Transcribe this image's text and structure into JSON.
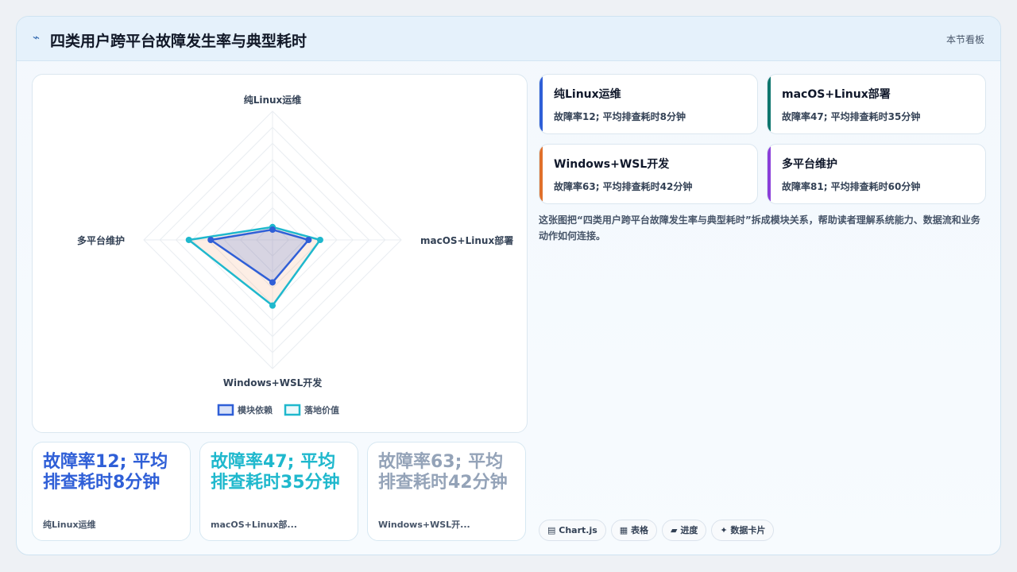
{
  "header": {
    "icon": "chart-line-icon",
    "title": "四类用户跨平台故障发生率与典型耗时",
    "right_label": "本节看板"
  },
  "chart_data": {
    "type": "radar",
    "axes": [
      "纯Linux运维",
      "macOS+Linux部署",
      "Windows+WSL开发",
      "多平台维护"
    ],
    "rlim": [
      0,
      100
    ],
    "grid": true,
    "legend_position": "bottom",
    "series": [
      {
        "name": "模块依赖",
        "values": [
          8,
          28,
          33,
          48
        ],
        "color": "#2f5fd7"
      },
      {
        "name": "落地价值",
        "values": [
          10,
          37,
          51,
          65
        ],
        "color": "#1fb8cd"
      }
    ]
  },
  "stat_cards": [
    {
      "value": "故障率12; 平均排查耗时8分钟",
      "label": "纯Linux运维",
      "color": "#2f5fd7"
    },
    {
      "value": "故障率47; 平均排查耗时35分钟",
      "label": "macOS+Linux部...",
      "color": "#1fb8cd"
    },
    {
      "value": "故障率63; 平均排查耗时42分钟",
      "label": "Windows+WSL开...",
      "color": "#94a3b8"
    }
  ],
  "info_cards": [
    {
      "title": "纯Linux运维",
      "desc": "故障率12; 平均排查耗时8分钟",
      "accent": "#2f5fd7"
    },
    {
      "title": "macOS+Linux部署",
      "desc": "故障率47; 平均排查耗时35分钟",
      "accent": "#0f766e"
    },
    {
      "title": "Windows+WSL开发",
      "desc": "故障率63; 平均排查耗时42分钟",
      "accent": "#e0702b"
    },
    {
      "title": "多平台维护",
      "desc": "故障率81; 平均排查耗时60分钟",
      "accent": "#8b3fd9"
    }
  ],
  "description": "这张图把“四类用户跨平台故障发生率与典型耗时”拆成模块关系，帮助读者理解系统能力、数据流和业务动作如何连接。",
  "tags": [
    {
      "icon": "chart-icon",
      "glyph": "▤",
      "label": "Chart.js"
    },
    {
      "icon": "table-icon",
      "glyph": "▦",
      "label": "表格"
    },
    {
      "icon": "progress-icon",
      "glyph": "▰",
      "label": "进度"
    },
    {
      "icon": "sparkle-icon",
      "glyph": "✦",
      "label": "数据卡片"
    }
  ]
}
